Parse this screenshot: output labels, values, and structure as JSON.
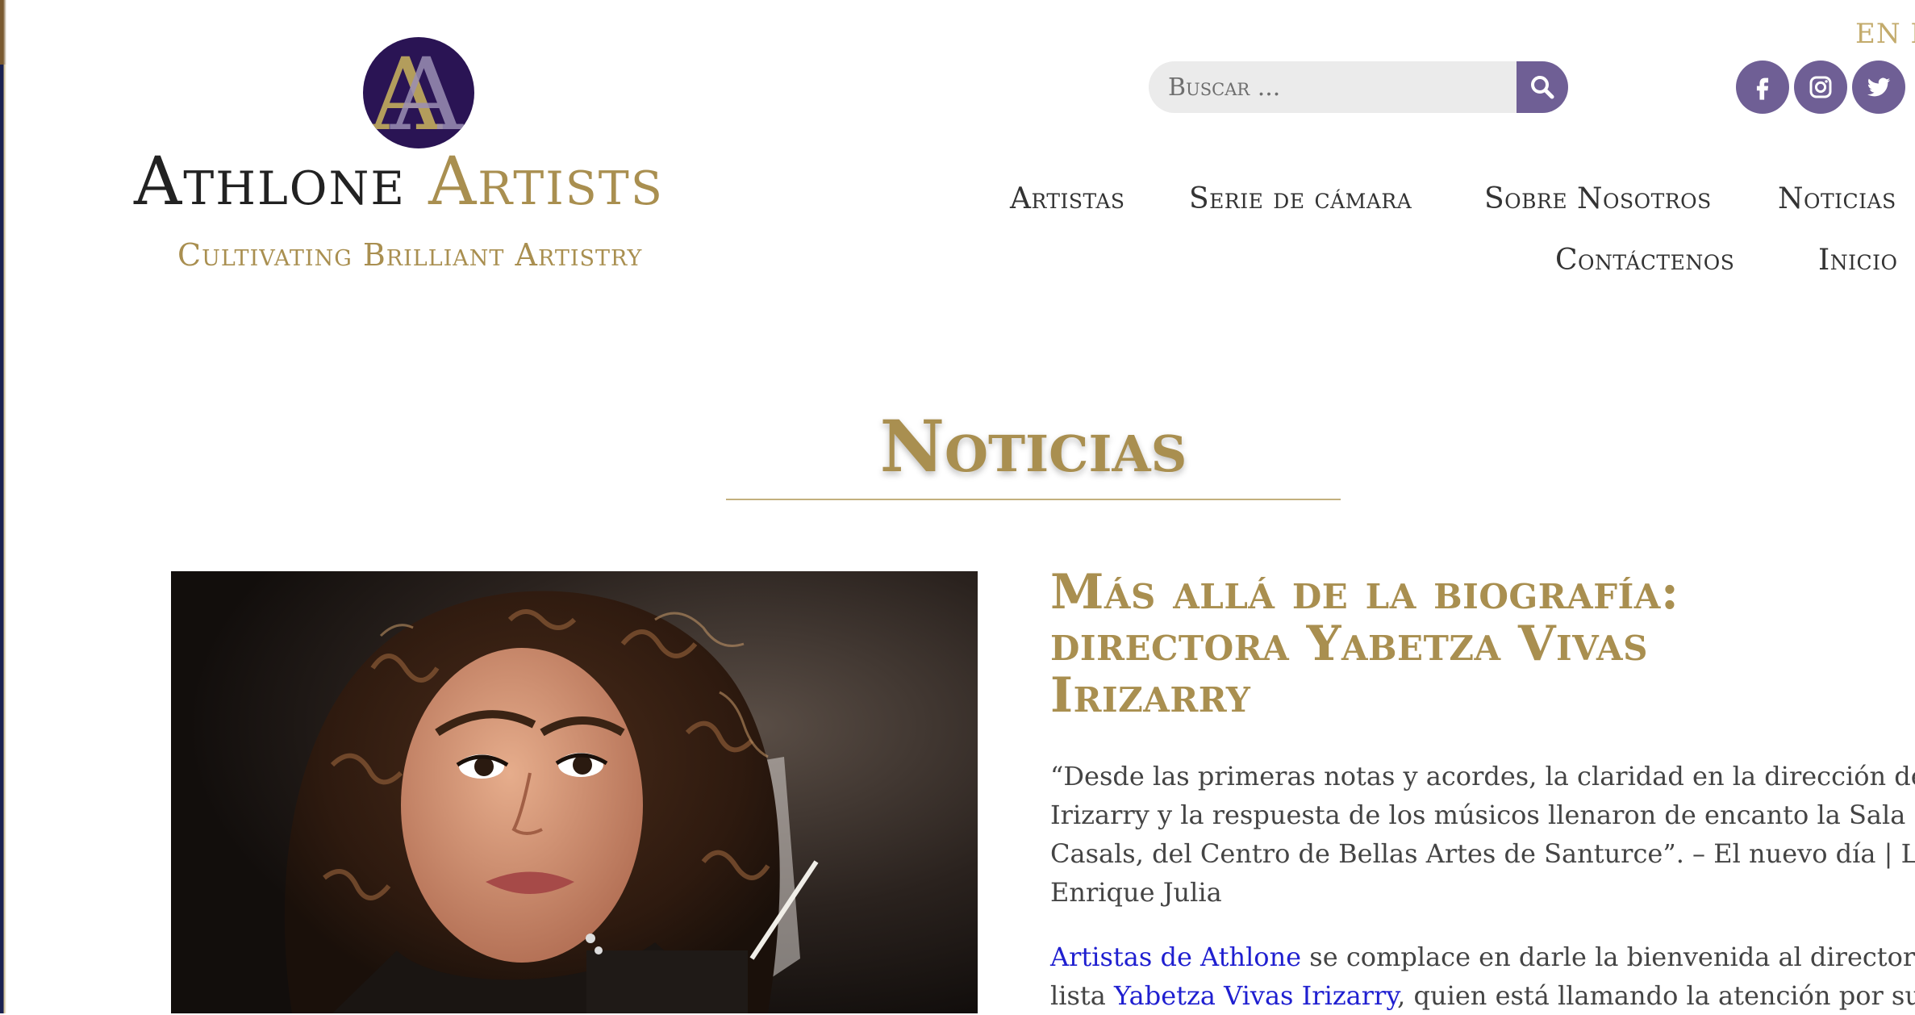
{
  "header": {
    "logo_name_part1": "Athlone",
    "logo_name_part2": "Artists",
    "tagline": "Cultivating Brilliant Artistry",
    "language_switch": "EN F",
    "search": {
      "placeholder": "Buscar ..."
    },
    "social": [
      "facebook-icon",
      "instagram-icon",
      "twitter-icon"
    ],
    "nav": {
      "artistas": "Artistas",
      "serie": "Serie de cámara",
      "sobre": "Sobre Nosotros",
      "noticias": "Noticias",
      "contactenos": "Contáctenos",
      "inicio": "Inicio"
    }
  },
  "colors": {
    "gold": "#a98f50",
    "purple": "#6f5f95",
    "logo_circle": "#2a1454",
    "link": "#1f1fd0"
  },
  "page_title": "Noticias",
  "article": {
    "title_line1": "Más allá de la biografía:",
    "title_line2": "directora Yabetza Vivas",
    "title_line3": "Irizarry",
    "quote_lines": [
      "“Desde las primeras notas y acordes, la claridad en la dirección de Viva",
      "Irizarry y la respuesta de los músicos llenaron de encanto la Sala Pablo",
      "Casals, del Centro de Bellas Artes de Santurce”.  – El nuevo día | Luis",
      "Enrique Julia"
    ],
    "body_link1": "Artistas de Athlone",
    "body_line1_rest": " se complace en darle la bienvenida al director de la",
    "body_line2_pre": "lista ",
    "body_link2": "Yabetza Vivas Irizarry",
    "body_line2_rest": ", quien está llamando la atención por su"
  }
}
